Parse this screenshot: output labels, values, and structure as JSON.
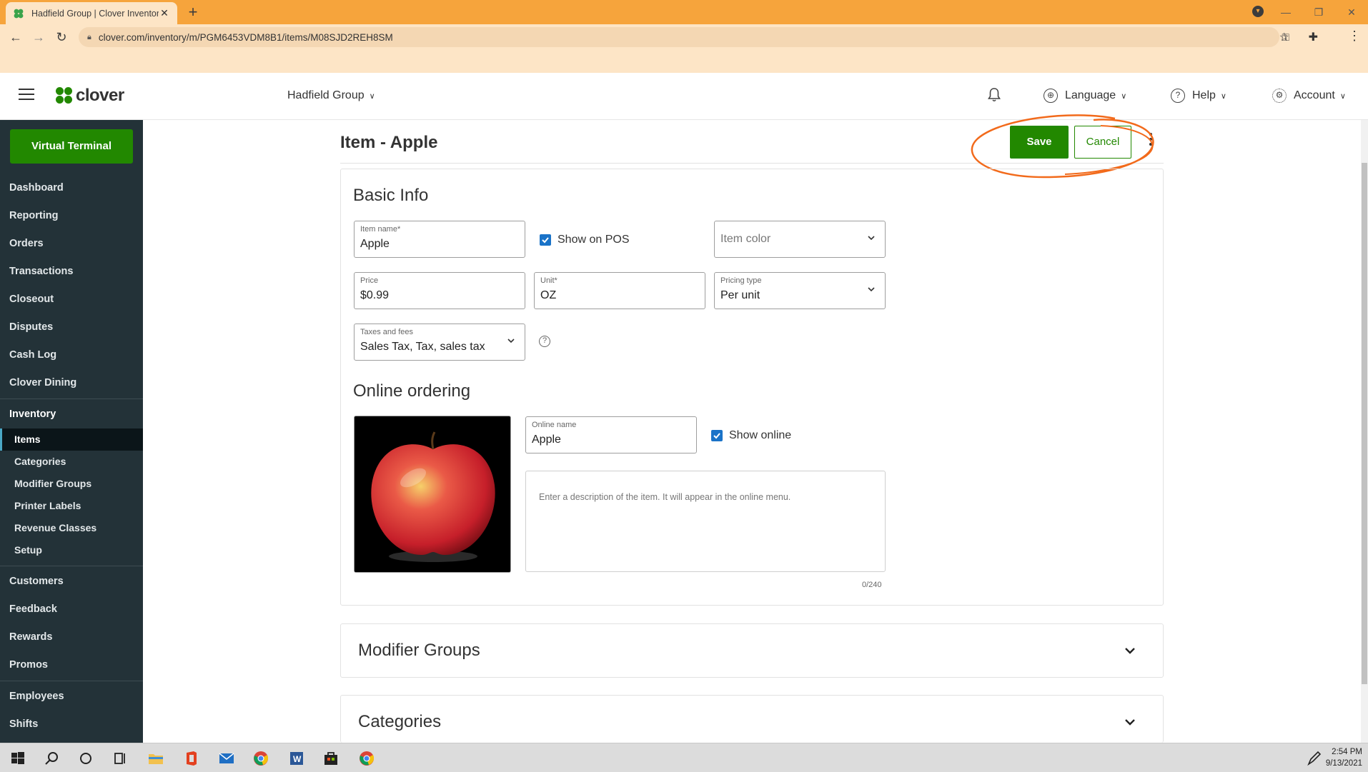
{
  "browser": {
    "tab_title": "Hadfield Group | Clover Inventory",
    "url": "clover.com/inventory/m/PGM6453VDM8B1/items/M08SJD2REH8SM"
  },
  "header": {
    "brand": "clover",
    "merchant": "Hadfield Group",
    "language": "Language",
    "help": "Help",
    "account": "Account"
  },
  "sidebar": {
    "virtual_terminal": "Virtual Terminal",
    "top_items": [
      "Dashboard",
      "Reporting",
      "Orders",
      "Transactions",
      "Closeout",
      "Disputes",
      "Cash Log",
      "Clover Dining"
    ],
    "inventory": "Inventory",
    "inventory_sub": [
      "Items",
      "Categories",
      "Modifier Groups",
      "Printer Labels",
      "Revenue Classes",
      "Setup"
    ],
    "mid_items": [
      "Customers",
      "Feedback",
      "Rewards",
      "Promos"
    ],
    "bottom_items": [
      "Employees",
      "Shifts"
    ]
  },
  "page": {
    "title": "Item - Apple",
    "save": "Save",
    "cancel": "Cancel"
  },
  "basic_info": {
    "heading": "Basic Info",
    "item_name_label": "Item name*",
    "item_name": "Apple",
    "show_on_pos": "Show on POS",
    "item_color_placeholder": "Item color",
    "price_label": "Price",
    "price": "$0.99",
    "unit_label": "Unit*",
    "unit": "OZ",
    "pricing_type_label": "Pricing type",
    "pricing_type": "Per unit",
    "taxes_label": "Taxes and fees",
    "taxes": "Sales Tax, Tax, sales tax"
  },
  "online_ordering": {
    "heading": "Online ordering",
    "online_name_label": "Online name",
    "online_name": "Apple",
    "show_online": "Show online",
    "description_placeholder": "Enter a description of the item. It will appear in the online menu.",
    "counter": "0/240"
  },
  "sections": {
    "modifier_groups": "Modifier Groups",
    "categories": "Categories"
  },
  "taskbar": {
    "time": "2:54 PM",
    "date": "9/13/2021"
  },
  "colors": {
    "brand_green": "#228800",
    "sidebar_bg": "#233238",
    "checkbox_blue": "#1a73c8",
    "annotation_orange": "#f26a1b"
  }
}
